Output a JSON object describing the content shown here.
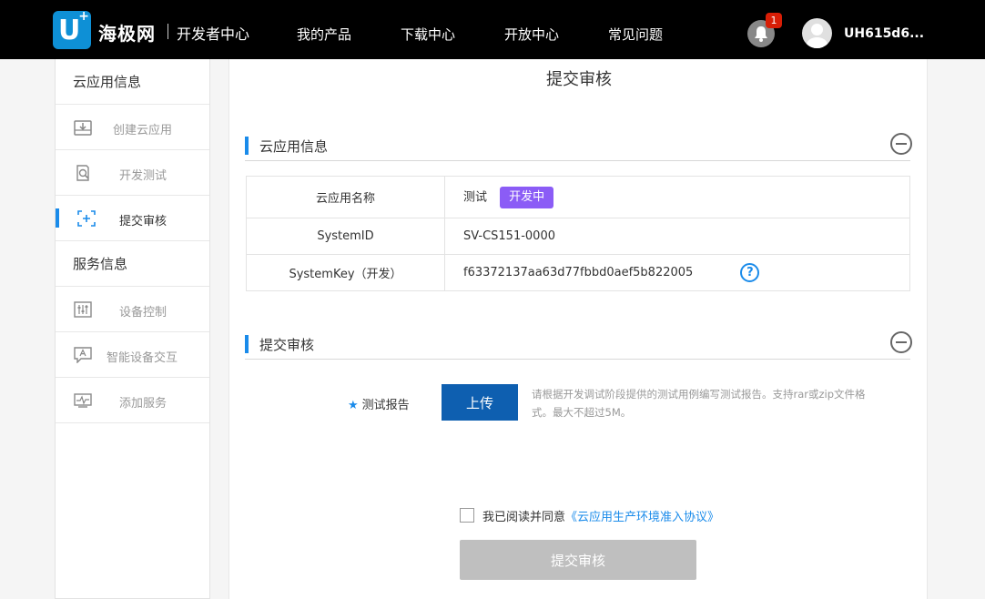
{
  "header": {
    "logo_letter": "U",
    "logo_plus": "+",
    "brand": "海极网",
    "sub_brand": "开发者中心",
    "nav": [
      {
        "label": "我的产品"
      },
      {
        "label": "下载中心"
      },
      {
        "label": "开放中心"
      },
      {
        "label": "常见问题"
      }
    ],
    "notification_count": "1",
    "username": "UH615d6..."
  },
  "sidebar": {
    "sections": [
      {
        "title": "云应用信息",
        "items": [
          {
            "label": "创建云应用",
            "icon": "download-box-icon"
          },
          {
            "label": "开发测试",
            "icon": "magnifier-doc-icon"
          },
          {
            "label": "提交审核",
            "icon": "plus-frame-icon",
            "active": true
          }
        ]
      },
      {
        "title": "服务信息",
        "items": [
          {
            "label": "设备控制",
            "icon": "sliders-icon"
          },
          {
            "label": "智能设备交互",
            "icon": "chat-a-icon"
          },
          {
            "label": "添加服务",
            "icon": "pulse-monitor-icon"
          }
        ]
      }
    ]
  },
  "main": {
    "page_title": "提交审核",
    "app_info": {
      "title": "云应用信息",
      "rows": [
        {
          "key": "云应用名称",
          "value": "测试",
          "tag": "开发中"
        },
        {
          "key": "SystemID",
          "value": "SV-CS151-0000"
        },
        {
          "key": "SystemKey（开发）",
          "value": "f63372137aa63d77fbbd0aef5b822005"
        }
      ]
    },
    "review": {
      "title": "提交审核",
      "required_mark": "★",
      "report_label": "测试报告",
      "upload_label": "上传",
      "hint": "请根据开发调试阶段提供的测试用例编写测试报告。支持rar或zip文件格式。最大不超过5M。"
    },
    "agreement": {
      "text": "我已阅读并同意",
      "link": "《云应用生产环境准入协议》"
    },
    "submit_label": "提交审核"
  },
  "colors": {
    "accent": "#1a8bea",
    "upload_button": "#0e5fb0",
    "tag": "#8b5cf6",
    "disabled_button": "#bfbfbf"
  }
}
